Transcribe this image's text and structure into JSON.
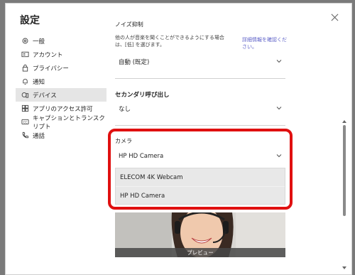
{
  "dialog": {
    "title": "設定",
    "close_icon": "close-icon"
  },
  "sidebar": {
    "items": [
      {
        "label": "一般",
        "icon": "gear-icon"
      },
      {
        "label": "アカウント",
        "icon": "account-card-icon"
      },
      {
        "label": "プライバシー",
        "icon": "lock-icon"
      },
      {
        "label": "通知",
        "icon": "bell-icon"
      },
      {
        "label": "デバイス",
        "icon": "devices-icon",
        "active": true
      },
      {
        "label": "アプリのアクセス許可",
        "icon": "apps-grid-icon"
      },
      {
        "label": "キャプションとトランスクリプト",
        "icon": "caption-icon"
      },
      {
        "label": "通話",
        "icon": "phone-icon"
      }
    ]
  },
  "content": {
    "noise_section_title": "ノイズ抑制",
    "noise_description": "他の人が音楽を聞くことができるようにする場合は、[低] を選びます。",
    "noise_link": "詳細情報を確認ください。",
    "noise_value": "自動 (既定)",
    "secondary_ringer": {
      "label": "セカンダリ呼び出し",
      "value": "なし"
    },
    "camera": {
      "label": "カメラ",
      "value": "HP HD Camera",
      "options": [
        "ELECOM 4K Webcam",
        "HP HD Camera"
      ]
    },
    "preview_label": "プレビュー"
  },
  "colors": {
    "highlight": "#e01010",
    "accent_link": "#5b5fc7",
    "overlay": "#7a7a7a"
  }
}
